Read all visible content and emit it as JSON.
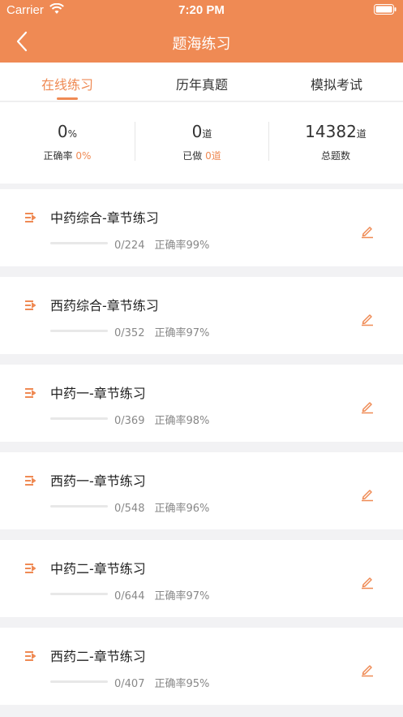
{
  "status_bar": {
    "carrier": "Carrier",
    "time": "7:20 PM"
  },
  "header": {
    "title": "题海练习"
  },
  "tabs": [
    {
      "label": "在线练习",
      "active": true
    },
    {
      "label": "历年真题",
      "active": false
    },
    {
      "label": "模拟考试",
      "active": false
    }
  ],
  "stats": [
    {
      "value": "0",
      "unit": "%",
      "label": "正确率",
      "highlight": "0%"
    },
    {
      "value": "0",
      "unit": "道",
      "label": "已做",
      "highlight": "0道"
    },
    {
      "value": "14382",
      "unit": "道",
      "label": "总题数",
      "highlight": ""
    }
  ],
  "courses": [
    {
      "title": "中药综合-章节练习",
      "progress": "0/224",
      "done": 0,
      "total": 224,
      "rate": "正确率99%"
    },
    {
      "title": "西药综合-章节练习",
      "progress": "0/352",
      "done": 0,
      "total": 352,
      "rate": "正确率97%"
    },
    {
      "title": "中药一-章节练习",
      "progress": "0/369",
      "done": 0,
      "total": 369,
      "rate": "正确率98%"
    },
    {
      "title": "西药一-章节练习",
      "progress": "0/548",
      "done": 0,
      "total": 548,
      "rate": "正确率96%"
    },
    {
      "title": "中药二-章节练习",
      "progress": "0/644",
      "done": 0,
      "total": 644,
      "rate": "正确率97%"
    },
    {
      "title": "西药二-章节练习",
      "progress": "0/407",
      "done": 0,
      "total": 407,
      "rate": "正确率95%"
    }
  ],
  "icons": {
    "back": "chevron-left-icon",
    "list": "list-icon",
    "edit": "pencil-icon",
    "wifi": "wifi-icon",
    "battery": "battery-icon"
  },
  "colors": {
    "accent": "#ef8a54",
    "background": "#f2f2f4",
    "card": "#ffffff"
  }
}
